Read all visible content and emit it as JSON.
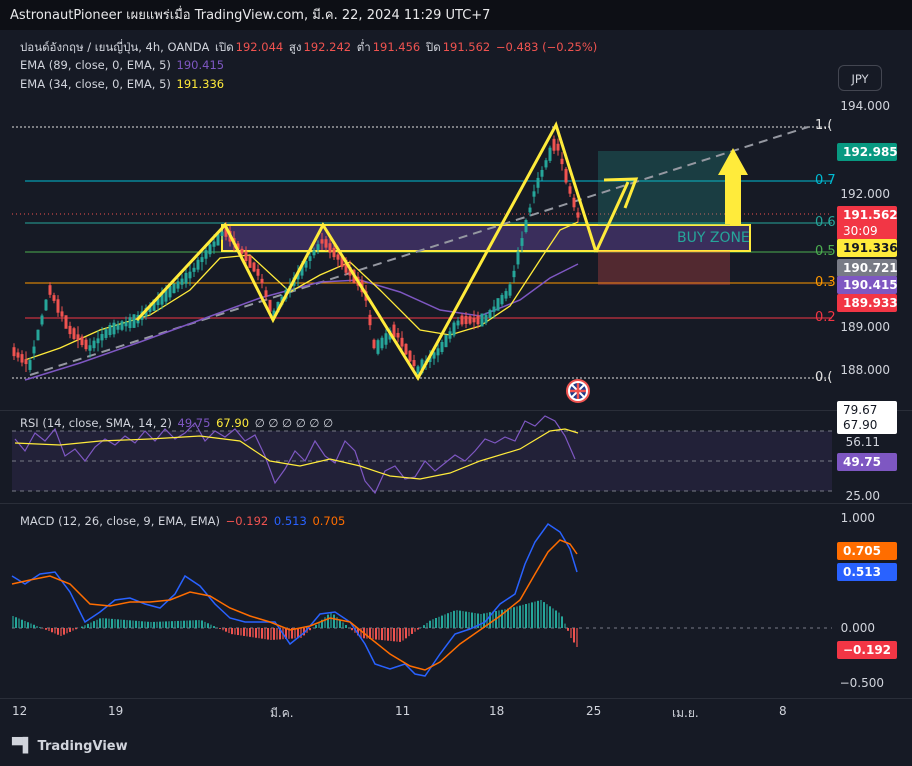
{
  "header": {
    "text": "AstronautPioneer เผยแพร่เมื่อ TradingView.com, มี.ค. 22, 2024 11:29 UTC+7"
  },
  "symbol": {
    "name": "ปอนด์อังกฤษ / เยนญี่ปุ่น, 4h, OANDA",
    "open_label": "เปิด",
    "open": "192.044",
    "high_label": "สูง",
    "high": "192.242",
    "low_label": "ต่ำ",
    "low": "191.456",
    "close_label": "ปิด",
    "close": "191.562",
    "change": "−0.483 (−0.25%)"
  },
  "indicators": {
    "ema89": {
      "label": "EMA (89, close, 0, EMA, 5)",
      "value": "190.415",
      "color": "#7e57c2"
    },
    "ema34": {
      "label": "EMA (34, close, 0, EMA, 5)",
      "value": "191.336",
      "color": "#ffeb3b"
    },
    "rsi": {
      "label": "RSI (14, close, SMA, 14, 2)",
      "v1": "49.75",
      "v2": "67.90",
      "extra": "∅ ∅ ∅ ∅ ∅ ∅"
    },
    "macd": {
      "label": "MACD (12, 26, close, 9, EMA, EMA)",
      "hist": "−0.192",
      "macd": "0.513",
      "signal": "0.705"
    }
  },
  "currency_button": "JPY",
  "price_axis": [
    "194.000",
    "192.000",
    "189.000",
    "188.000"
  ],
  "price_tags": {
    "target": "192.985",
    "last": "191.562",
    "countdown": "30:09",
    "ema34": "191.336",
    "level": "190.721",
    "ema89": "190.415",
    "stop": "189.933"
  },
  "fib_labels": [
    "1.(",
    "0.7",
    "0.6",
    "0.5",
    "0.3",
    "0.2",
    "0.("
  ],
  "buy_zone_label": "BUY ZONE",
  "rsi_axis": {
    "top": "79.67",
    "v_67": "67.90",
    "v_56": "56.11",
    "v_49": "49.75",
    "bottom": "25.00"
  },
  "macd_axis": {
    "top": "1.000",
    "zero": "0.000",
    "bottom": "−0.500",
    "signal": "0.705",
    "macd": "0.513",
    "hist": "−0.192"
  },
  "time_axis": [
    "12",
    "19",
    "มี.ค.",
    "11",
    "18",
    "25",
    "เม.ย.",
    "8"
  ],
  "footer": "TradingView",
  "colors": {
    "bg": "#161a25",
    "up": "#26a69a",
    "down": "#ef5350",
    "yellow": "#ffeb3b",
    "purple": "#7e57c2",
    "macd": "#2962ff",
    "signal": "#ff6d00"
  }
}
